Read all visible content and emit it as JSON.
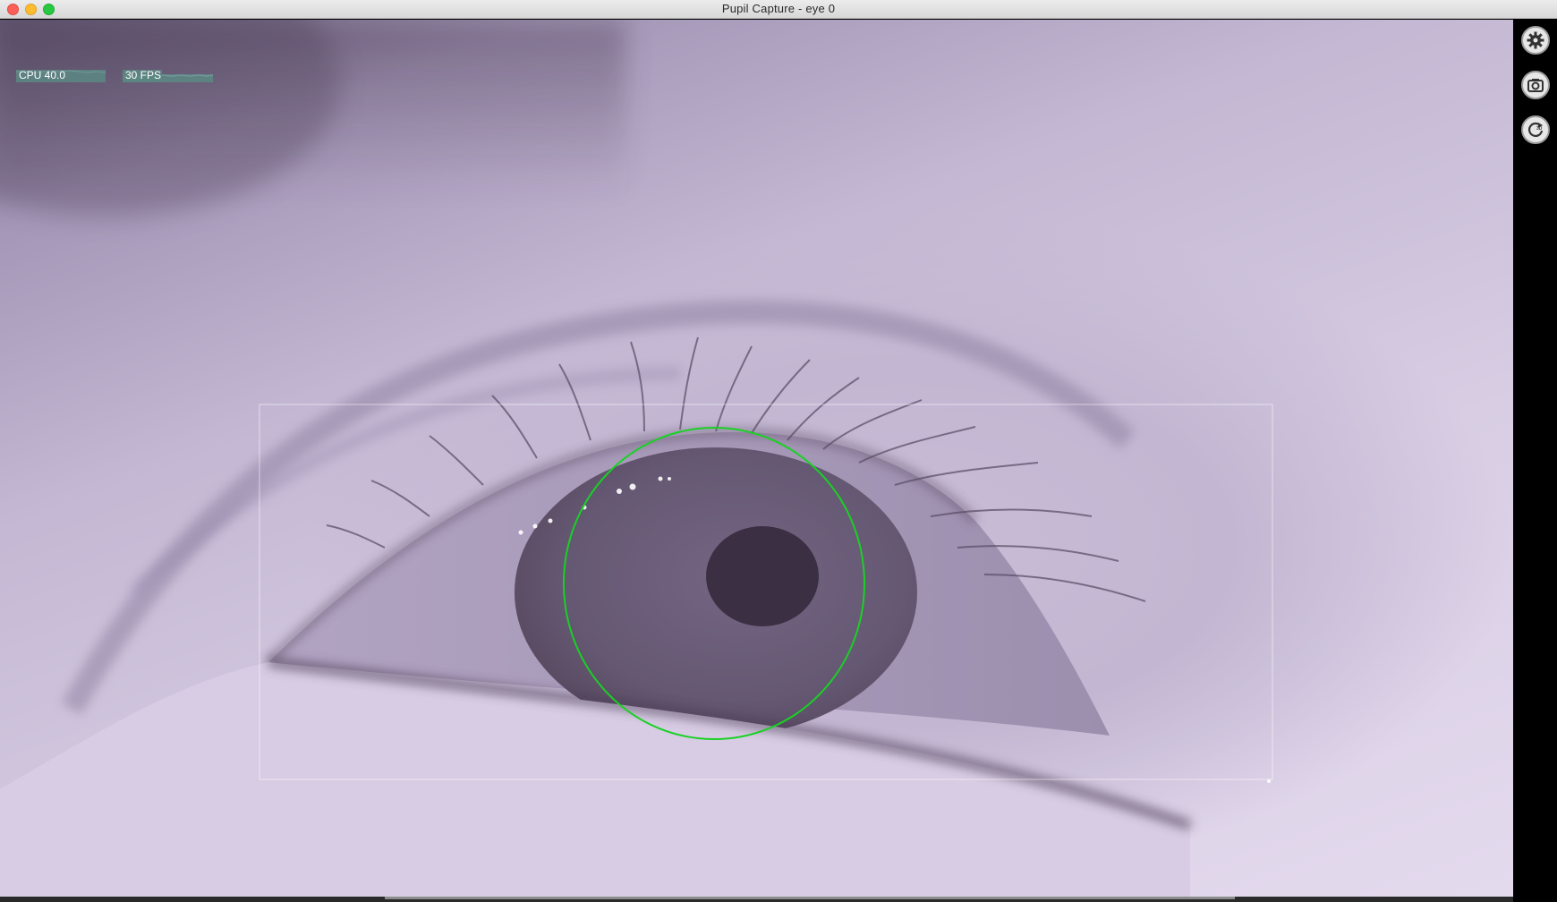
{
  "window": {
    "title": "Pupil Capture - eye 0"
  },
  "graphs": {
    "cpu_label": "CPU 40.0",
    "fps_label": "30 FPS"
  },
  "toolbar": {
    "settings_icon": "gear-icon",
    "capture_icon": "camera-icon",
    "model_icon": "3d-reset-icon"
  },
  "detection": {
    "pupil_circle_color": "#19d124",
    "roi_color": "#ffffff"
  }
}
